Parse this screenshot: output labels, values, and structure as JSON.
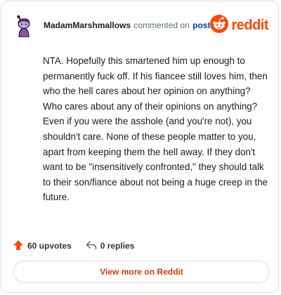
{
  "comment": {
    "username": "MadamMarshmallows",
    "action_text": "commented on",
    "post_link_label": "post",
    "body": "NTA. Hopefully this smartened him up enough to permanently fuck off. If his fiancee still loves him, then who the hell cares about her opinion on anything? Who cares about any of their opinions on anything? Even if you were the asshole (and you're not), you shouldn't care. None of these people matter to you, apart from keeping them the hell away. If they don't want to be \"insensitively confronted,\" they should talk to their son/fiance about not being a huge creep in the future."
  },
  "brand": {
    "name": "reddit",
    "icon": "reddit-logo-icon",
    "color": "#ff4500"
  },
  "stats": {
    "upvotes": "60 upvotes",
    "upvote_icon": "upvote-arrow-icon",
    "upvote_color": "#ff4500",
    "replies": "0 replies",
    "reply_icon": "reply-arrow-icon"
  },
  "actions": {
    "view_more_label": "View more on Reddit",
    "view_more_color": "#d93a00"
  },
  "avatar": {
    "icon": "user-avatar-icon",
    "accent": "#8b4fb0"
  }
}
